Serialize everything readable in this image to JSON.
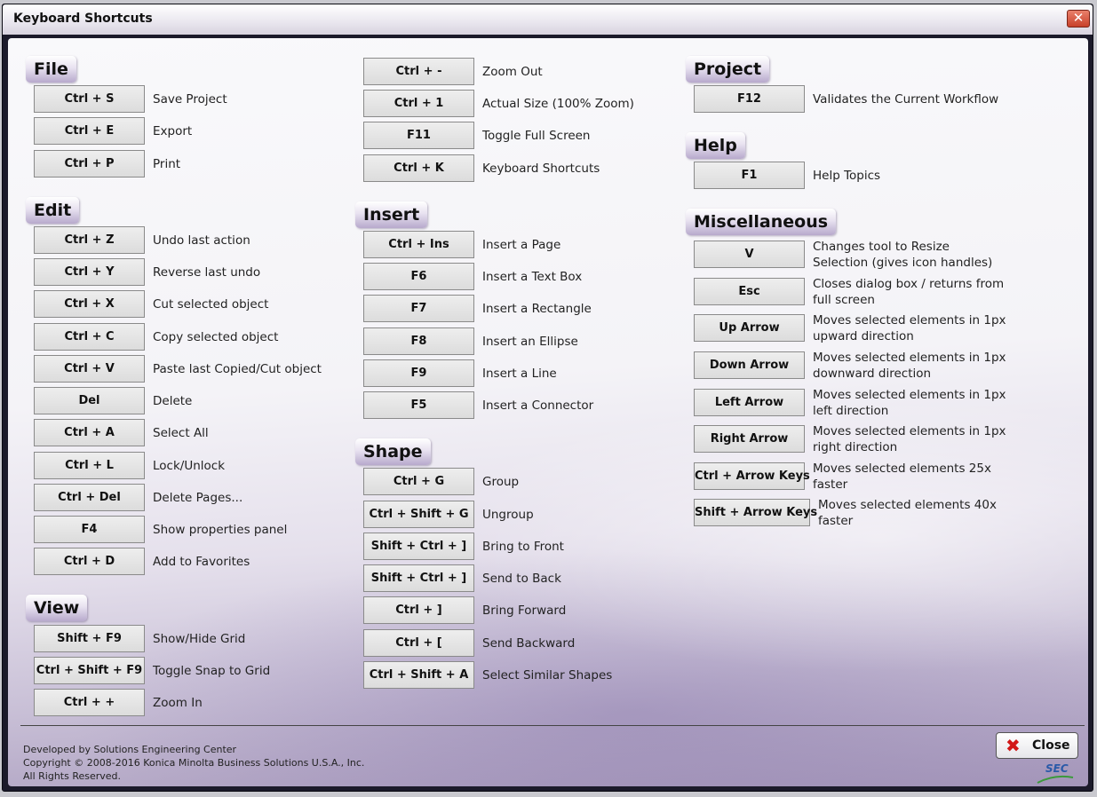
{
  "window": {
    "title": "Keyboard Shortcuts",
    "close_glyph": "✕"
  },
  "sections": {
    "file": {
      "title": "File",
      "items": [
        {
          "key": "Ctrl + S",
          "desc": "Save Project"
        },
        {
          "key": "Ctrl + E",
          "desc": "Export"
        },
        {
          "key": "Ctrl + P",
          "desc": "Print"
        }
      ]
    },
    "edit": {
      "title": "Edit",
      "items": [
        {
          "key": "Ctrl + Z",
          "desc": "Undo last action"
        },
        {
          "key": "Ctrl + Y",
          "desc": "Reverse last undo"
        },
        {
          "key": "Ctrl + X",
          "desc": "Cut selected object"
        },
        {
          "key": "Ctrl + C",
          "desc": "Copy selected object"
        },
        {
          "key": "Ctrl + V",
          "desc": "Paste last Copied/Cut object"
        },
        {
          "key": "Del",
          "desc": "Delete"
        },
        {
          "key": "Ctrl + A",
          "desc": "Select All"
        },
        {
          "key": "Ctrl + L",
          "desc": "Lock/Unlock"
        },
        {
          "key": "Ctrl + Del",
          "desc": "Delete Pages..."
        },
        {
          "key": "F4",
          "desc": "Show properties panel"
        },
        {
          "key": "Ctrl + D",
          "desc": "Add to Favorites"
        }
      ]
    },
    "view": {
      "title": "View",
      "items": [
        {
          "key": "Shift + F9",
          "desc": "Show/Hide Grid"
        },
        {
          "key": "Ctrl + Shift + F9",
          "desc": "Toggle Snap to Grid"
        },
        {
          "key": "Ctrl + +",
          "desc": "Zoom In"
        },
        {
          "key": "Ctrl + -",
          "desc": "Zoom Out"
        },
        {
          "key": "Ctrl + 1",
          "desc": "Actual Size (100% Zoom)"
        },
        {
          "key": "F11",
          "desc": "Toggle Full Screen"
        },
        {
          "key": "Ctrl + K",
          "desc": "Keyboard Shortcuts"
        }
      ]
    },
    "insert": {
      "title": "Insert",
      "items": [
        {
          "key": "Ctrl + Ins",
          "desc": "Insert a Page"
        },
        {
          "key": "F6",
          "desc": "Insert a Text Box"
        },
        {
          "key": "F7",
          "desc": "Insert a Rectangle"
        },
        {
          "key": "F8",
          "desc": "Insert an Ellipse"
        },
        {
          "key": "F9",
          "desc": "Insert a Line"
        },
        {
          "key": "F5",
          "desc": "Insert a Connector"
        }
      ]
    },
    "shape": {
      "title": "Shape",
      "items": [
        {
          "key": "Ctrl + G",
          "desc": "Group"
        },
        {
          "key": "Ctrl + Shift + G",
          "desc": "Ungroup"
        },
        {
          "key": "Shift + Ctrl + ]",
          "desc": "Bring to Front"
        },
        {
          "key": "Shift + Ctrl + ]",
          "desc": "Send to Back"
        },
        {
          "key": "Ctrl + ]",
          "desc": "Bring Forward"
        },
        {
          "key": "Ctrl + [",
          "desc": "Send Backward"
        },
        {
          "key": "Ctrl + Shift + A",
          "desc": "Select Similar Shapes"
        }
      ]
    },
    "project": {
      "title": "Project",
      "items": [
        {
          "key": "F12",
          "desc": "Validates the Current Workflow"
        }
      ]
    },
    "help": {
      "title": "Help",
      "items": [
        {
          "key": "F1",
          "desc": "Help Topics"
        }
      ]
    },
    "misc": {
      "title": "Miscellaneous",
      "items": [
        {
          "key": "V",
          "desc": "Changes tool to Resize Selection (gives icon handles)"
        },
        {
          "key": "Esc",
          "desc": "Closes dialog box / returns from full screen"
        },
        {
          "key": "Up Arrow",
          "desc": "Moves selected elements in 1px upward direction"
        },
        {
          "key": "Down Arrow",
          "desc": "Moves selected elements in 1px downward direction"
        },
        {
          "key": "Left Arrow",
          "desc": "Moves selected elements in 1px left direction"
        },
        {
          "key": "Right Arrow",
          "desc": "Moves selected elements in 1px right direction"
        },
        {
          "key": "Ctrl + Arrow Keys",
          "desc": "Moves selected elements 25x faster"
        },
        {
          "key": "Shift + Arrow Keys",
          "desc": "Moves selected elements 40x faster"
        }
      ]
    }
  },
  "footer": {
    "line1": "Developed by Solutions Engineering Center",
    "line2": "Copyright © 2008-2016 Konica Minolta Business Solutions U.S.A., Inc.",
    "line3": "All Rights Reserved."
  },
  "close_button": {
    "label": "Close",
    "icon": "close-x-icon"
  },
  "logo": {
    "text": "SEC"
  },
  "colors": {
    "accent": "#a597ba",
    "close_icon": "#d21818",
    "logo": "#2a5aa8"
  }
}
